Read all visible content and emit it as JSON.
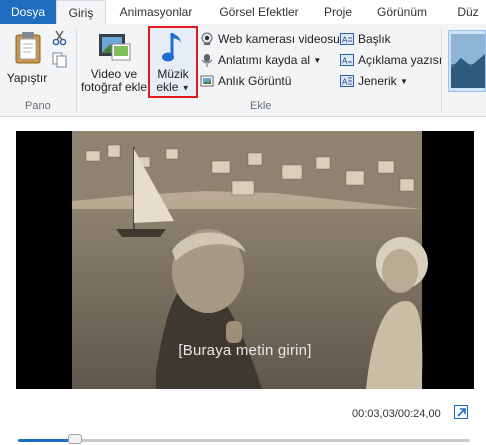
{
  "tabs": [
    {
      "label": "Dosya"
    },
    {
      "label": "Giriş"
    },
    {
      "label": "Animasyonlar"
    },
    {
      "label": "Görsel Efektler"
    },
    {
      "label": "Proje"
    },
    {
      "label": "Görünüm"
    },
    {
      "label": "Düz"
    }
  ],
  "ribbon": {
    "pano": {
      "paste_label": "Yapıştır",
      "group_label": "Pano"
    },
    "ekle": {
      "add_video_label_1": "Video ve",
      "add_video_label_2": "fotoğraf ekle",
      "add_music_label_1": "Müzik",
      "add_music_label_2": "ekle",
      "webcam_label": "Web kamerası videosu",
      "narration_label": "Anlatımı kayda al",
      "snapshot_label": "Anlık Görüntü",
      "title_label": "Başlık",
      "caption_label": "Açıklama yazısı",
      "credits_label": "Jenerik",
      "group_label": "Ekle"
    }
  },
  "preview": {
    "subtitle": "[Buraya metin girin]",
    "time": "00:03,03/00:24,00",
    "progress": 0.126
  },
  "colors": {
    "accent": "#1e6bbf",
    "highlight": "#e01b1b"
  }
}
